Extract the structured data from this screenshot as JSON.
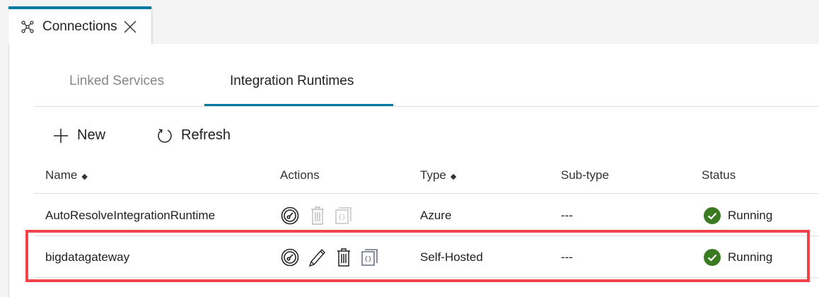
{
  "doc_tab": {
    "title": "Connections",
    "icon": "connections-icon"
  },
  "tabs": [
    {
      "label": "Linked Services",
      "active": false
    },
    {
      "label": "Integration Runtimes",
      "active": true
    }
  ],
  "toolbar": {
    "new_label": "New",
    "refresh_label": "Refresh"
  },
  "table": {
    "headers": {
      "name": "Name",
      "actions": "Actions",
      "type": "Type",
      "subtype": "Sub-type",
      "status": "Status"
    },
    "rows": [
      {
        "name": "AutoResolveIntegrationRuntime",
        "type": "Azure",
        "subtype": "---",
        "status": "Running",
        "actions": [
          "monitor-icon",
          "delete-icon (disabled)",
          "code-icon (disabled)"
        ]
      },
      {
        "name": "bigdatagateway",
        "type": "Self-Hosted",
        "subtype": "---",
        "status": "Running",
        "actions": [
          "monitor-icon",
          "edit-icon",
          "delete-icon",
          "code-icon"
        ],
        "highlighted": true
      }
    ]
  },
  "colors": {
    "accent": "#0078a0",
    "running": "#3a7b22",
    "highlight": "#f0434a"
  }
}
